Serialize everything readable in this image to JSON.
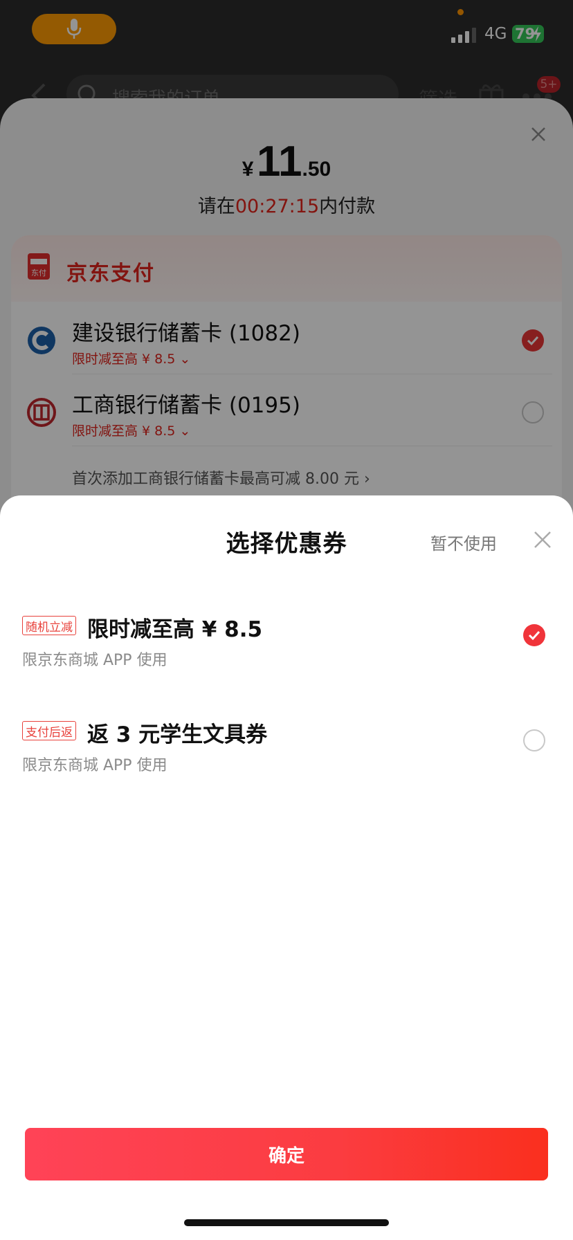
{
  "status_bar": {
    "network": "4G",
    "battery": "79"
  },
  "search_header": {
    "placeholder": "搜索我的订单",
    "filter_label": "筛选",
    "badge": "5+"
  },
  "payment": {
    "currency_symbol": "¥",
    "amount_int": "11",
    "amount_dec": ".50",
    "deadline_prefix": "请在",
    "deadline_timer": "00:27:15",
    "deadline_suffix": "内付款",
    "jd_pay_title": "京东支付",
    "jd_pay_logo_text": "东付",
    "cards": [
      {
        "name": "建设银行储蓄卡 (1082)",
        "promo": "限时减至高 ¥ 8.5 ⌄",
        "selected": true
      },
      {
        "name": "工商银行储蓄卡 (0195)",
        "promo": "限时减至高 ¥ 8.5 ⌄",
        "selected": false
      }
    ],
    "add_card_tip": "首次添加工商银行储蓄卡最高可减 8.00 元 ›"
  },
  "coupon_sheet": {
    "title": "选择优惠券",
    "not_use_label": "暂不使用",
    "coupons": [
      {
        "tag": "随机立减",
        "title": "限时减至高 ¥ 8.5",
        "desc": "限京东商城 APP 使用",
        "selected": true
      },
      {
        "tag": "支付后返",
        "title": "返 3 元学生文具券",
        "desc": "限京东商城 APP 使用",
        "selected": false
      }
    ],
    "confirm_label": "确定"
  },
  "colors": {
    "accent_red": "#f0343a",
    "mic_orange": "#ff9b05",
    "battery_green": "#34c759"
  }
}
